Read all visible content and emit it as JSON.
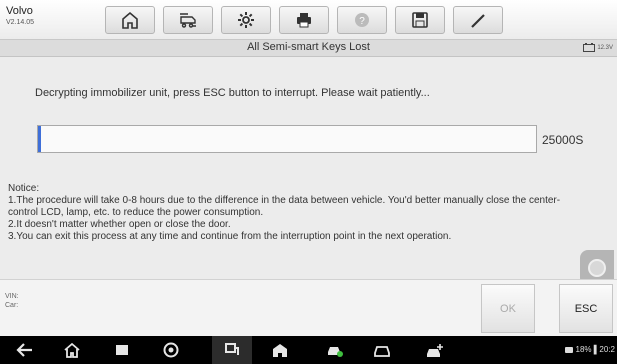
{
  "header": {
    "brand": "Volvo",
    "version": "V2.14.05",
    "toolbar": [
      {
        "icon": "home-icon"
      },
      {
        "icon": "vehicle-swap-icon"
      },
      {
        "icon": "gear-icon"
      },
      {
        "icon": "printer-icon"
      },
      {
        "icon": "help-icon"
      },
      {
        "icon": "save-icon"
      },
      {
        "icon": "pen-icon"
      }
    ]
  },
  "titlebar": {
    "title": "All Semi-smart Keys Lost",
    "battery": "12.3V"
  },
  "main": {
    "message": "Decrypting immobilizer unit, press ESC button to interrupt. Please wait patiently...",
    "progress_fraction": 0.006,
    "progress_value": "25000S",
    "notice": {
      "heading": "Notice:",
      "lines": [
        "1.The procedure will take 0-8 hours due to the difference in the data between vehicle. You'd better manually close the center-control LCD, lamp, etc. to reduce the power consumption.",
        "2.It doesn't matter whether open or close the door.",
        "3.You can exit this process at any time and continue from the interruption point in the next operation."
      ]
    }
  },
  "footer": {
    "vin_label": "VIN:",
    "car_label": "Car:",
    "ok_label": "OK",
    "esc_label": "ESC"
  },
  "navbar": {
    "status_text": "18% ▌20:2"
  },
  "colors": {
    "progress_accent": "#3f6fd8",
    "background": "#ececec"
  }
}
